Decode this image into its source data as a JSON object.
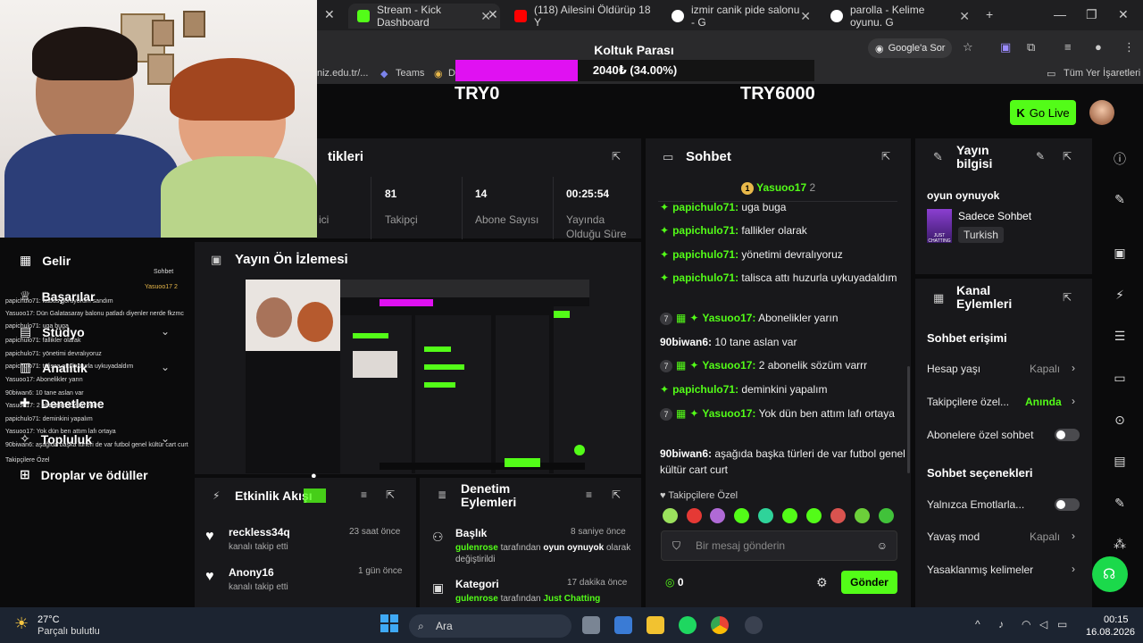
{
  "browser": {
    "tabs": [
      {
        "title": "Stream - Kick Dashboard"
      },
      {
        "title": "(118) Ailesini Öldürüp 18 Y"
      },
      {
        "title": "izmir canik pide salonu - G"
      },
      {
        "title": "parolla - Kelime oyunu. G"
      }
    ],
    "google_ask": "Google'a Sor",
    "bookmarks": {
      "left": "niz.edu.tr/...",
      "teams": "Teams",
      "d": "D",
      "all": "Tüm Yer İşaretleri"
    }
  },
  "goal": {
    "title": "Koltuk Parası",
    "progress_text": "2040₺ (34.00%)",
    "progress": 0.34,
    "min": "TRY0",
    "max": "TRY6000"
  },
  "header": {
    "go_live": "Go Live"
  },
  "stats": {
    "title": "tikleri",
    "partial_label": "ici",
    "followers": {
      "value": "81",
      "label": "Takipçi"
    },
    "subs": {
      "value": "14",
      "label": "Abone Sayısı"
    },
    "uptime": {
      "value": "00:25:54",
      "label": "Yayında Olduğu Süre"
    }
  },
  "nav": {
    "revenue": "Gelir",
    "achievements": "Başarılar",
    "studio": "Stüdyo",
    "analytics": "Analitik",
    "moderation": "Denetleme",
    "community": "Topluluk",
    "drops": "Droplar ve ödüller"
  },
  "preview": {
    "title": "Yayın Ön İzlemesi"
  },
  "overlay": {
    "header": "Sohbet",
    "pinned": "Yasuoo17 2",
    "lines": [
      "papichulo71: kabus görüyorum sandım",
      "Yasuoo17: Dün Galatasaray balonu patladı diyenler nerde fkzmc",
      "papichulo71: uga buga",
      "papichulo71: fallikler olarak",
      "papichulo71: yönetimi devralıyoruz",
      "papichulo71: talisca attı huzurla uykuyadaldım",
      "Yasuoo17: Abonelikler yarın",
      "90biwan6: 10 tane aslan var",
      "Yasuoo17: 2 abonelik sözüm varrr",
      "papichulo71: deminkini yapalım",
      "Yasuoo17: Yok dün ben attım lafı ortaya",
      "90biwan6: aşağıda başka türleri de var futbol genel kültür cart curt"
    ],
    "followers_only": "Takipçilere Özel"
  },
  "activity": {
    "title": "Etkinlik Akışı",
    "items": [
      {
        "user": "reckless34q",
        "text": "kanalı takip etti",
        "time": "23 saat önce"
      },
      {
        "user": "Anony16",
        "text": "kanalı takip etti",
        "time": "1 gün önce"
      }
    ]
  },
  "mod_actions": {
    "title": "Denetim Eylemleri",
    "items": [
      {
        "kind": "Başlık",
        "time": "8 saniye önce",
        "actor": "gulenrose",
        "mid": "tarafından",
        "value": "oyun oynuyok",
        "tail": "olarak değiştirildi"
      },
      {
        "kind": "Kategori",
        "time": "17 dakika önce",
        "actor": "gulenrose",
        "mid": "tarafından",
        "value": "Just Chatting"
      }
    ]
  },
  "chat": {
    "title": "Sohbet",
    "pinned_user": "Yasuoo17",
    "pinned_count": "2",
    "messages": [
      {
        "badge": "",
        "user": "papichulo71:",
        "text": "uga buga"
      },
      {
        "badge": "",
        "user": "papichulo71:",
        "text": "fallikler olarak"
      },
      {
        "badge": "",
        "user": "papichulo71:",
        "text": "yönetimi devralıyoruz"
      },
      {
        "badge": "",
        "user": "papichulo71:",
        "text": "talisca attı huzurla uykuyadaldım"
      },
      {
        "badge": "7",
        "user": "Yasuoo17:",
        "text": "Abonelikler yarın"
      },
      {
        "badge": "",
        "user": "90biwan6:",
        "text": "10 tane aslan var"
      },
      {
        "badge": "7",
        "user": "Yasuoo17:",
        "text": "2 abonelik sözüm varrr"
      },
      {
        "badge": "",
        "user": "papichulo71:",
        "text": "deminkini yapalım"
      },
      {
        "badge": "7",
        "user": "Yasuoo17:",
        "text": "Yok dün ben attım lafı ortaya"
      },
      {
        "badge": "",
        "user": "90biwan6:",
        "text": "aşağıda başka türleri de var futbol genel kültür cart curt"
      }
    ],
    "followers_only": "Takipçilere Özel",
    "placeholder": "Bir mesaj gönderin",
    "points": "0",
    "send": "Gönder"
  },
  "stream_info": {
    "title": "Yayın bilgisi",
    "stream_title": "oyun oynuyok",
    "category": "Sadece Sohbet",
    "category_thumb": "JUST CHATTING",
    "language": "Turkish"
  },
  "channel_actions": {
    "title": "Kanal Eylemleri",
    "chat_access": "Sohbet erişimi",
    "account_age": {
      "label": "Hesap yaşı",
      "value": "Kapalı"
    },
    "followers_only": {
      "label": "Takipçilere özel...",
      "value": "Anında"
    },
    "subs_only": {
      "label": "Abonelere özel sohbet"
    },
    "chat_options": "Sohbet seçenekleri",
    "emotes_only": {
      "label": "Yalnızca Emotlarla..."
    },
    "slow_mode": {
      "label": "Yavaş mod",
      "value": "Kapalı"
    },
    "banned_words": {
      "label": "Yasaklanmış kelimeler"
    }
  },
  "taskbar": {
    "weather_temp": "27°C",
    "weather_desc": "Parçalı bulutlu",
    "search": "Ara",
    "time": "00:15",
    "date": "16.08.2026"
  },
  "colors": {
    "accent": "#53fc18",
    "goal_fill": "#e011f2",
    "panel": "#18181b"
  }
}
